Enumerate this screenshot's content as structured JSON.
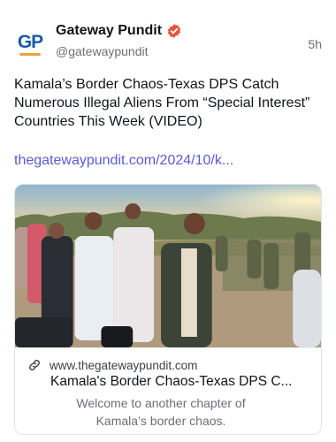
{
  "post": {
    "author": {
      "name": "Gateway Pundit",
      "handle": "@gatewaypundit",
      "avatar_text": "GP"
    },
    "timestamp": "5h",
    "text": "Kamala’s Border Chaos-Texas DPS Catch Numerous Illegal Aliens From “Special Interest” Countries This Week (VIDEO)",
    "link_text": "thegatewaypundit.com/2024/10/k...",
    "card": {
      "domain": "www.thegatewaypundit.com",
      "title": "Kamala's Border Chaos-Texas DPS C...",
      "description": "Welcome to another chapter of Kamala’s border chaos.",
      "image_icon": "news-photo"
    }
  },
  "colors": {
    "link": "#5a5ad6",
    "verified_badge": "#e6553e",
    "logo_blue": "#1a5aa8",
    "logo_orange": "#e8a33b",
    "muted_text": "#6b6f75"
  }
}
